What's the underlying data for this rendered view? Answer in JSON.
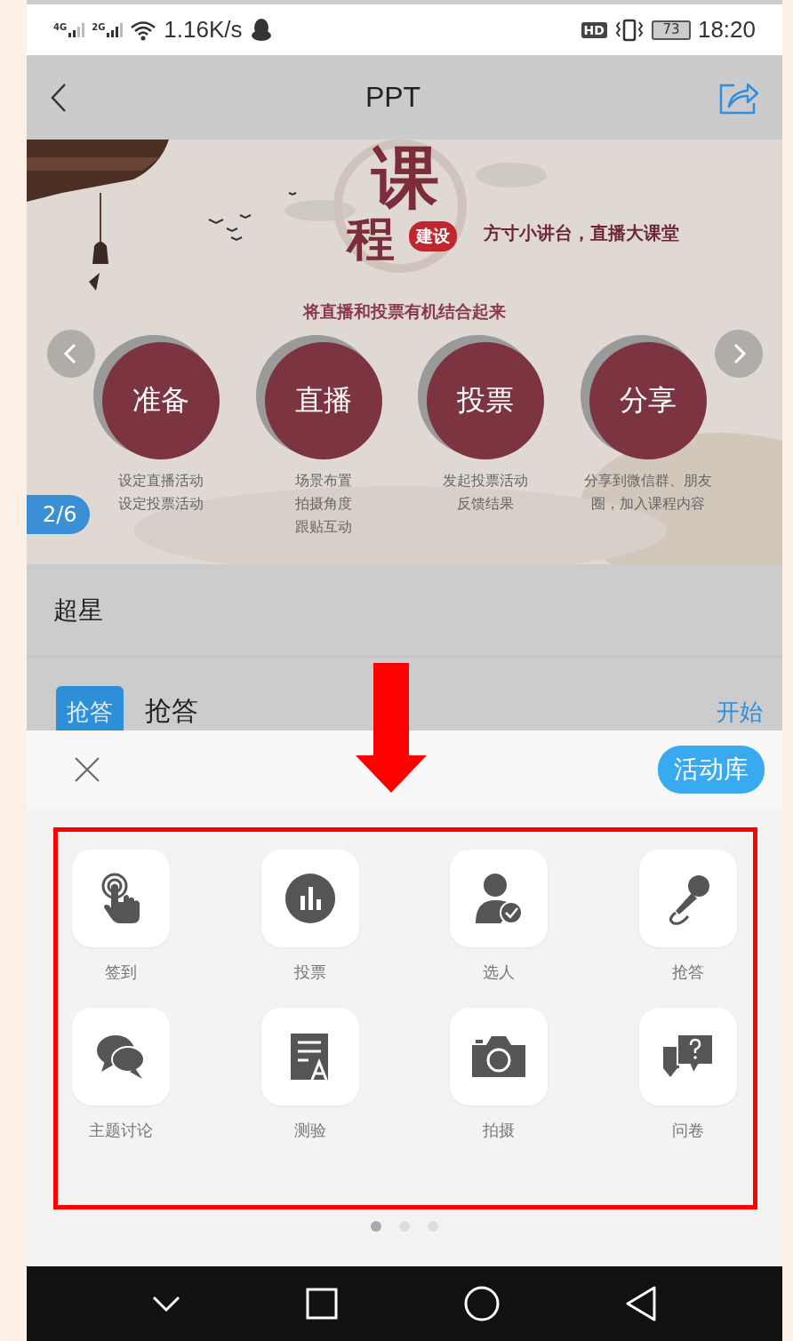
{
  "status_bar": {
    "network_1": "4G",
    "network_2": "2G",
    "speed": "1.16K/s",
    "hd": "HD",
    "battery": "73",
    "time": "18:20"
  },
  "nav": {
    "title": "PPT"
  },
  "slide": {
    "title_top": "课",
    "title_bottom": "程",
    "stamp": "建设",
    "tagline": "方寸小讲台，直播大课堂",
    "subtitle": "将直播和投票有机结合起来",
    "page": "2/6",
    "steps": [
      {
        "label": "准备",
        "lines": [
          "设定直播活动",
          "设定投票活动"
        ]
      },
      {
        "label": "直播",
        "lines": [
          "场景布置",
          "拍摄角度",
          "跟贴互动"
        ]
      },
      {
        "label": "投票",
        "lines": [
          "发起投票活动",
          "反馈结果"
        ]
      },
      {
        "label": "分享",
        "lines": [
          "分享到微信群、朋友",
          "圈，加入课程内容"
        ]
      }
    ]
  },
  "course_name": "超星",
  "activity_row": {
    "badge": "抢答",
    "name": "抢答",
    "action": "开始"
  },
  "sheet": {
    "library_button": "活动库",
    "items": [
      {
        "kind": "sign-in",
        "label": "签到"
      },
      {
        "kind": "vote",
        "label": "投票"
      },
      {
        "kind": "pick",
        "label": "选人"
      },
      {
        "kind": "answer",
        "label": "抢答"
      },
      {
        "kind": "discussion",
        "label": "主题讨论"
      },
      {
        "kind": "quiz",
        "label": "测验"
      },
      {
        "label": "拍摄"
      },
      {
        "kind": "survey",
        "label": "问卷"
      }
    ],
    "page_dots": [
      {
        "selected": true
      },
      {
        "selected": false
      },
      {
        "selected": false
      }
    ]
  }
}
